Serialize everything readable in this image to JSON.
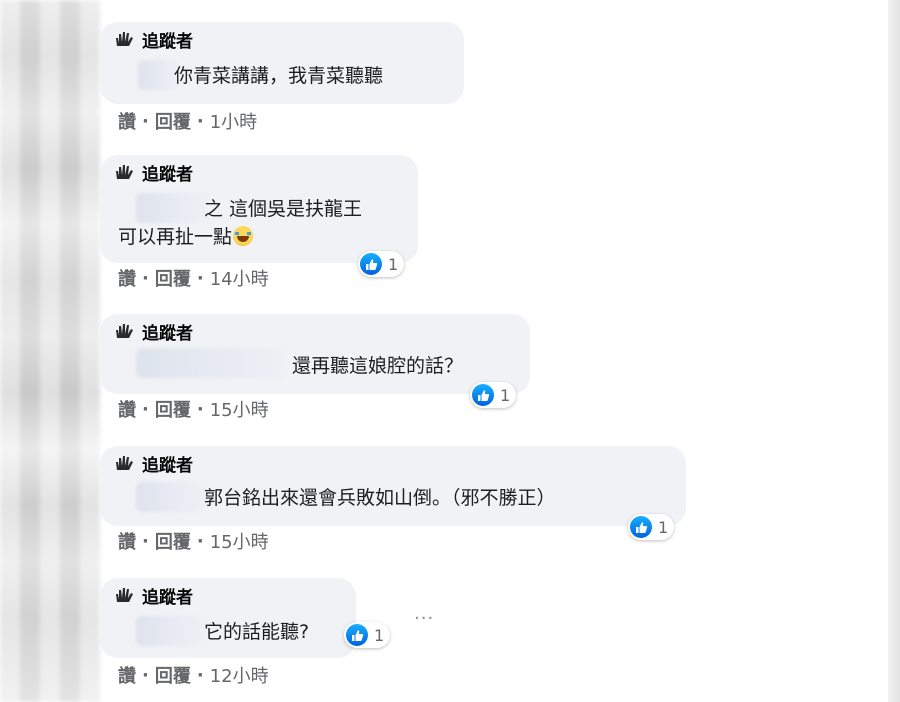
{
  "comments": [
    {
      "author": "追蹤者",
      "lines": [
        "你青菜講講，我青菜聽聽"
      ],
      "reaction_count": "",
      "actions": {
        "like": "讚",
        "reply": "回覆",
        "time": "1小時"
      }
    },
    {
      "author": "追蹤者",
      "lines": [
        "之 這個吳是扶龍王",
        "可以再扯一點"
      ],
      "reaction_count": "1",
      "actions": {
        "like": "讚",
        "reply": "回覆",
        "time": "14小時"
      }
    },
    {
      "author": "追蹤者",
      "lines": [
        "還再聽這娘腔的話？"
      ],
      "reaction_count": "1",
      "actions": {
        "like": "讚",
        "reply": "回覆",
        "time": "15小時"
      }
    },
    {
      "author": "追蹤者",
      "lines": [
        "郭台銘出來還會兵敗如山倒。（邪不勝正）"
      ],
      "reaction_count": "1",
      "actions": {
        "like": "讚",
        "reply": "回覆",
        "time": "15小時"
      }
    },
    {
      "author": "追蹤者",
      "lines": [
        "它的話能聽?"
      ],
      "reaction_count": "1",
      "actions": {
        "like": "讚",
        "reply": "回覆",
        "time": "12小時"
      }
    }
  ],
  "icons": {
    "author_badge": "follower-hand-icon",
    "reaction": "like-reaction-icon",
    "emoji": "laughing-crying-emoji-icon",
    "more": "more-options-icon"
  },
  "more_options_label": "···",
  "colors": {
    "bubble": "#f0f2f5",
    "like_blue": "#1877f2",
    "meta_gray": "#65676b",
    "text": "#050505"
  }
}
